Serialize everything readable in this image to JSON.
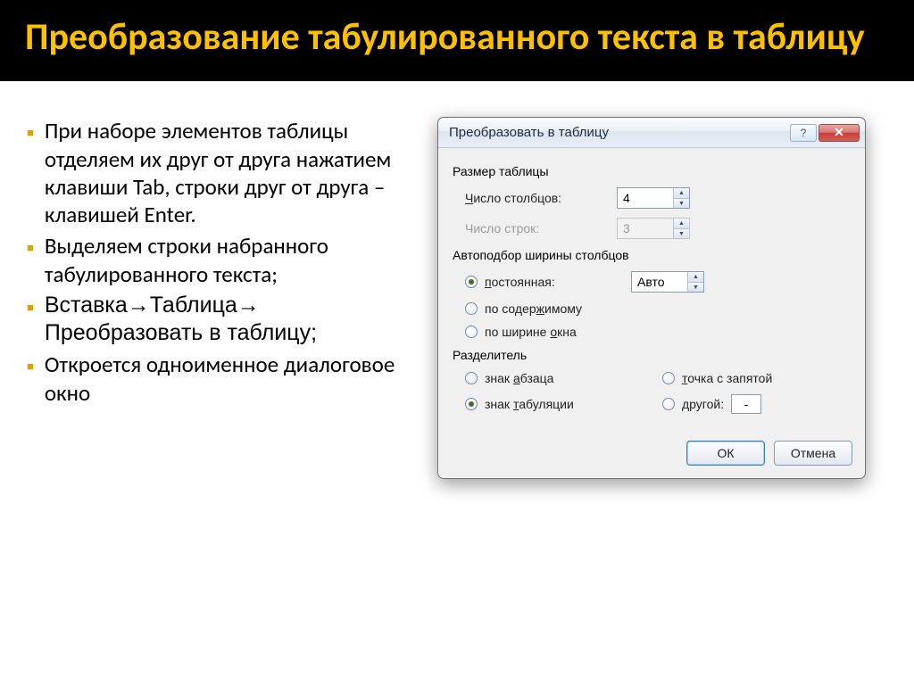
{
  "slide": {
    "title": "Преобразование табулированного текста в таблицу",
    "bullets": [
      "При наборе элементов таблицы отделяем их друг от друга нажатием клавиши Tab, строки друг от друга – клавишей Enter.",
      "Выделяем строки набранного табулированного текста;",
      "Вставка→Таблица→ Преобразовать в таблицу;",
      "Откроется одноименное диалоговое окно"
    ]
  },
  "dialog": {
    "title": "Преобразовать в таблицу",
    "help_glyph": "?",
    "close_glyph": "✕",
    "size_header": "Размер таблицы",
    "cols_label_u": "Ч",
    "cols_label_rest": "исло столбцов:",
    "cols_value": "4",
    "rows_label": "Число строк:",
    "rows_value": "3",
    "autofit_header": "Автоподбор ширины столбцов",
    "fixed_u": "п",
    "fixed_rest": "остоянная:",
    "fixed_value": "Авто",
    "by_content": "по содер",
    "by_content_u": "ж",
    "by_content_rest": "имому",
    "by_window": "по ширине ",
    "by_window_u": "о",
    "by_window_rest": "кна",
    "sep_header": "Разделитель",
    "sep_para": "знак ",
    "sep_para_u": "а",
    "sep_para_rest": "бзаца",
    "sep_semi_u": "т",
    "sep_semi_rest": "очка с запятой",
    "sep_tab": "знак ",
    "sep_tab_u": "т",
    "sep_tab_rest": "абуляции",
    "sep_other_u": "д",
    "sep_other_rest": "ругой:",
    "sep_other_value": "-",
    "ok": "ОК",
    "cancel": "Отмена"
  }
}
